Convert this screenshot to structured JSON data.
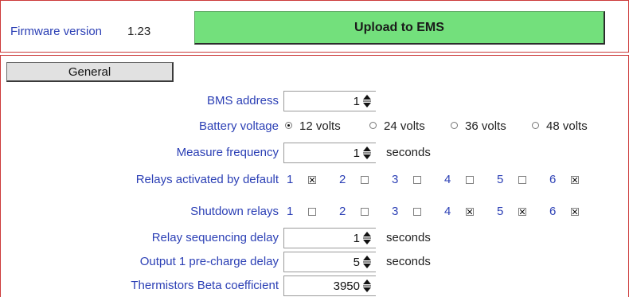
{
  "header": {
    "firmware_label": "Firmware version",
    "firmware_value": "1.23",
    "upload_label": "Upload to EMS"
  },
  "tabs": [
    {
      "label": "General",
      "selected": true
    }
  ],
  "general": {
    "bms_address": {
      "label": "BMS address",
      "value": "1"
    },
    "battery_voltage": {
      "label": "Battery voltage",
      "options": [
        "12 volts",
        "24 volts",
        "36 volts",
        "48 volts"
      ],
      "selected": "12 volts"
    },
    "measure_frequency": {
      "label": "Measure frequency",
      "value": "1",
      "unit": "seconds"
    },
    "relays_default": {
      "label": "Relays activated by default",
      "relays": [
        {
          "num": "1",
          "checked": true
        },
        {
          "num": "2",
          "checked": false
        },
        {
          "num": "3",
          "checked": false
        },
        {
          "num": "4",
          "checked": false
        },
        {
          "num": "5",
          "checked": false
        },
        {
          "num": "6",
          "checked": true
        }
      ]
    },
    "shutdown_relays": {
      "label": "Shutdown relays",
      "relays": [
        {
          "num": "1",
          "checked": false
        },
        {
          "num": "2",
          "checked": false
        },
        {
          "num": "3",
          "checked": false
        },
        {
          "num": "4",
          "checked": true
        },
        {
          "num": "5",
          "checked": true
        },
        {
          "num": "6",
          "checked": true
        }
      ]
    },
    "relay_seq_delay": {
      "label": "Relay sequencing delay",
      "value": "1",
      "unit": "seconds"
    },
    "precharge_delay": {
      "label": "Output 1 pre-charge delay",
      "value": "5",
      "unit": "seconds"
    },
    "thermistor_beta": {
      "label": "Thermistors Beta coefficient",
      "value": "3950"
    }
  },
  "colors": {
    "accent_label": "#2b3fb5",
    "upload_bg": "#73e07c",
    "frame_border": "#cc3a3a"
  }
}
